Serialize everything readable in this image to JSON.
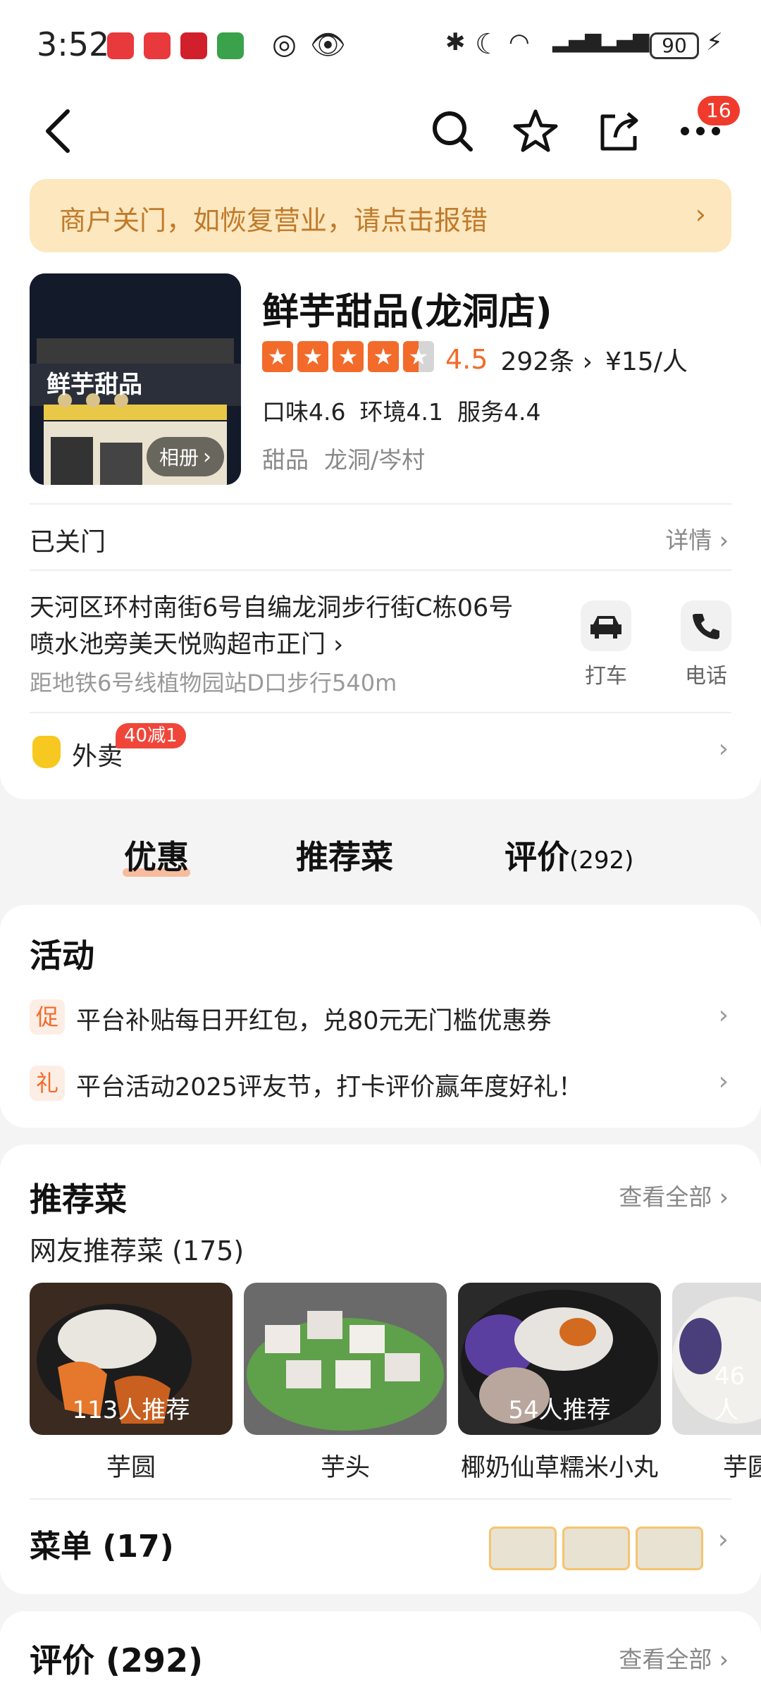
{
  "status_bar": {
    "time": "3:52",
    "battery": "90"
  },
  "nav": {
    "more_badge": "16"
  },
  "banner": {
    "text": "商户关门，如恢复营业，请点击报错"
  },
  "store": {
    "name": "鲜芋甜品(龙洞店)",
    "photo_sign": "鲜芋甜品",
    "album_label": "相册",
    "rating": "4.5",
    "review_count": "292条",
    "price": "¥15/人",
    "scores": [
      "口味4.6",
      "环境4.1",
      "服务4.4"
    ],
    "category": "甜品",
    "area": "龙洞/岑村",
    "status": "已关门",
    "detail_label": "详情",
    "address_line1": "天河区环村南街6号自编龙洞步行街C栋06号",
    "address_line2": "喷水池旁美天悦购超市正门",
    "subway": "距地铁6号线植物园站D口步行540m",
    "taxi_label": "打车",
    "phone_label": "电话",
    "delivery_label": "外卖",
    "delivery_promo": "40减1"
  },
  "tabs": [
    {
      "label": "优惠"
    },
    {
      "label": "推荐菜"
    },
    {
      "label": "评价",
      "count": "(292)"
    }
  ],
  "activities": {
    "title": "活动",
    "items": [
      {
        "tag": "促",
        "text": "平台补贴每日开红包，兑80元无门槛优惠券"
      },
      {
        "tag": "礼",
        "text": "平台活动2025评友节，打卡评价赢年度好礼！"
      }
    ]
  },
  "recommended": {
    "title": "推荐菜",
    "see_all": "查看全部",
    "subtitle": "网友推荐菜 (175)",
    "dishes": [
      {
        "name": "芋圆",
        "count": "113人推荐"
      },
      {
        "name": "芋头",
        "count": ""
      },
      {
        "name": "椰奶仙草糯米小丸",
        "count": "54人推荐"
      },
      {
        "name": "芋圆",
        "count": "46人"
      }
    ],
    "menu_label": "菜单 (17)"
  },
  "reviews": {
    "title": "评价 (292)",
    "see_all": "查看全部"
  },
  "colors": {
    "accent": "#f26b2a",
    "banner_bg": "#fce7bf",
    "banner_text": "#c07a2a",
    "badge_red": "#f03a2c"
  }
}
